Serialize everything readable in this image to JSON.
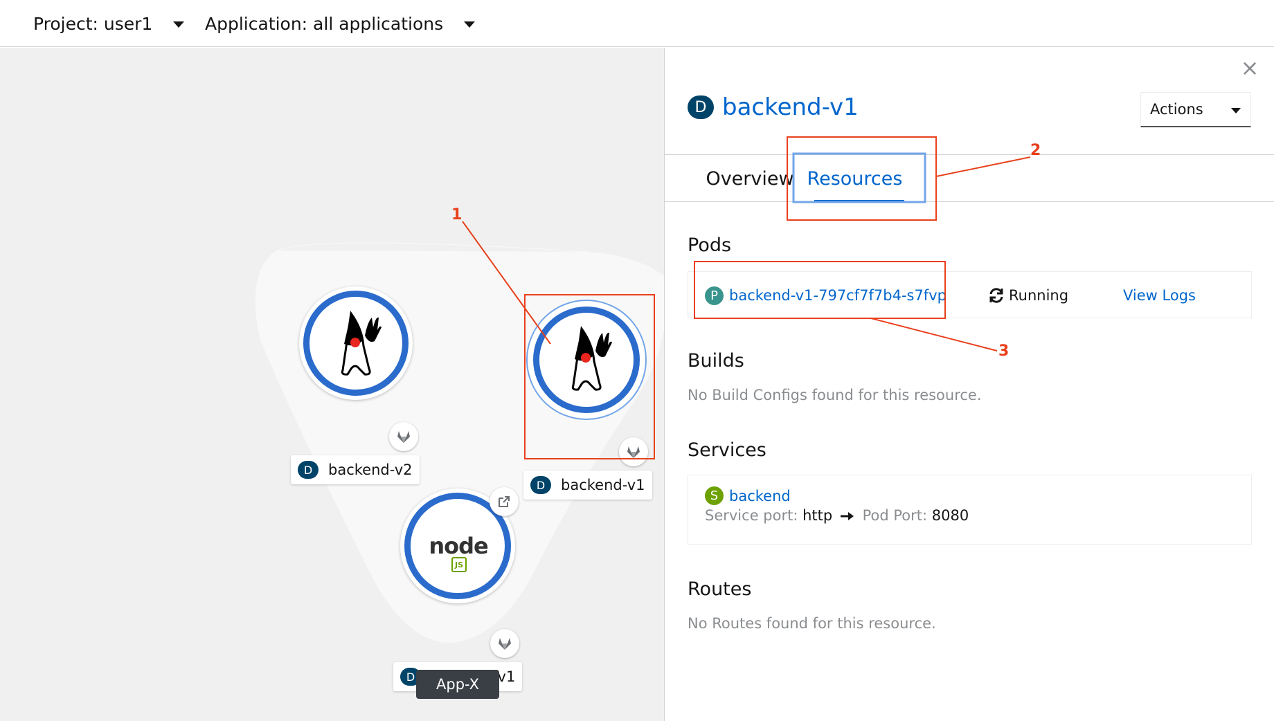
{
  "topbar": {
    "project_label": "Project: user1",
    "application_label": "Application: all applications"
  },
  "topology": {
    "group_label": "App-X",
    "nodes": [
      {
        "name": "backend-v2",
        "kind": "D",
        "icon": "java-duke-icon"
      },
      {
        "name": "backend-v1",
        "kind": "D",
        "icon": "java-duke-icon",
        "selected": true
      },
      {
        "name": "frontend-v1",
        "kind": "D",
        "icon": "nodejs-icon"
      }
    ],
    "ring_color": "#2b6bcc",
    "node_logo_text": "node",
    "node_logo_sub": "JS"
  },
  "panel": {
    "close_glyph": "×",
    "resource_kind": "D",
    "resource_name": "backend-v1",
    "actions_label": "Actions",
    "tabs": [
      {
        "label": "Overview",
        "active": false
      },
      {
        "label": "Resources",
        "active": true
      }
    ],
    "pods": {
      "title": "Pods",
      "items": [
        {
          "kind": "P",
          "name": "backend-v1-797cf7f7b4-s7fvp",
          "status": "Running",
          "logs_label": "View Logs"
        }
      ]
    },
    "builds": {
      "title": "Builds",
      "empty": "No Build Configs found for this resource."
    },
    "services": {
      "title": "Services",
      "items": [
        {
          "kind": "S",
          "name": "backend",
          "service_port_label": "Service port:",
          "service_port": "http",
          "pod_port_label": "Pod Port:",
          "pod_port": "8080"
        }
      ]
    },
    "routes": {
      "title": "Routes",
      "empty": "No Routes found for this resource."
    }
  },
  "annotations": {
    "color": "#e8401c",
    "callouts": [
      "1",
      "2",
      "3"
    ]
  }
}
